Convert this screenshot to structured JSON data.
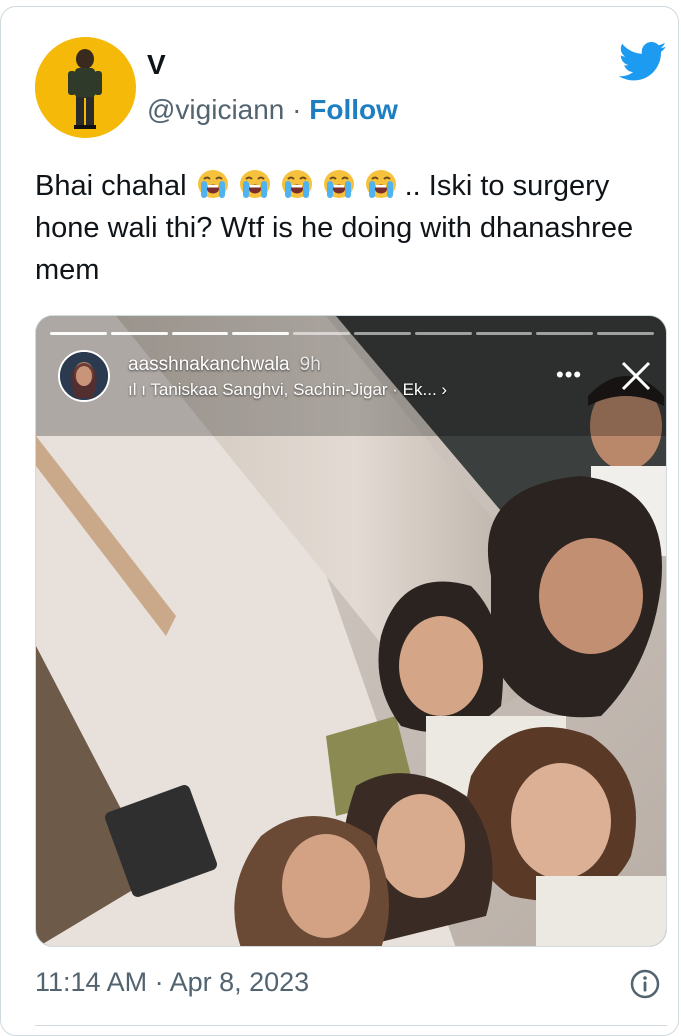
{
  "author": {
    "display_name": "V",
    "handle": "@vigiciann",
    "separator": "·",
    "follow_label": "Follow"
  },
  "tweet": {
    "text_before": "Bhai chahal",
    "emoji_name": "loudly-crying-face",
    "emoji_count": 5,
    "text_after": ".. Iski to surgery hone wali thi? Wtf is he doing with dhanashree mem"
  },
  "media": {
    "story_username": "aasshnakanchwala",
    "story_time": "9h",
    "story_music": "Taniskaa Sanghvi, Sachin-Jigar · Ek... ›",
    "story_more": "•••",
    "icons": {
      "music": "audio-bars-icon",
      "close": "close-icon",
      "more": "more-dots-icon"
    }
  },
  "footer": {
    "timestamp": "11:14 AM · Apr 8, 2023",
    "info_icon": "info-icon"
  },
  "colors": {
    "brand": "#1d9bf0",
    "follow": "#1d7ec2",
    "secondary_text": "#536471",
    "avatar_bg": "#f5b90a"
  }
}
